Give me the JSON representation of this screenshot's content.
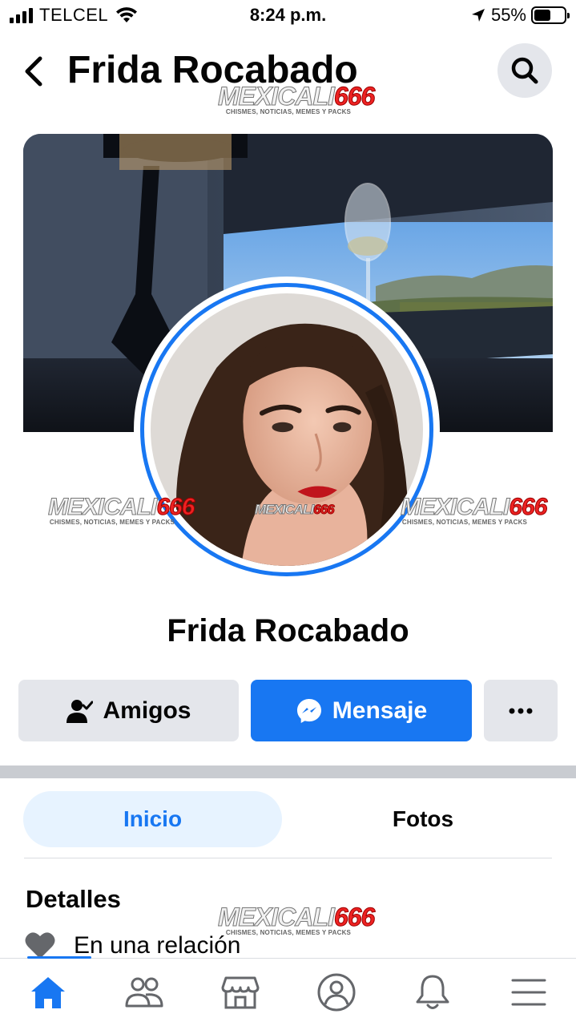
{
  "status_bar": {
    "carrier": "TELCEL",
    "time": "8:24 p.m.",
    "battery_percent": "55%",
    "battery_level": 0.55
  },
  "header": {
    "title": "Frida Rocabado"
  },
  "watermark": {
    "brand_a": "MEXICALI",
    "brand_b": "666",
    "tagline": "CHISMES, NOTICIAS, MEMES Y PACKS"
  },
  "profile": {
    "name": "Frida Rocabado"
  },
  "actions": {
    "friends_label": "Amigos",
    "message_label": "Mensaje"
  },
  "tabs": {
    "home_label": "Inicio",
    "photos_label": "Fotos"
  },
  "details": {
    "title": "Detalles",
    "relationship": "En una relación"
  },
  "colors": {
    "accent": "#1877f2",
    "button_gray": "#e4e6eb",
    "tab_active_bg": "#e7f3ff"
  },
  "icons": {
    "back": "chevron-left-icon",
    "search": "search-icon",
    "friends": "friend-check-icon",
    "messenger": "messenger-icon",
    "more": "more-dots-icon",
    "heart": "heart-icon",
    "nav": [
      "home-icon",
      "friends-icon",
      "marketplace-icon",
      "profile-icon",
      "bell-icon",
      "menu-icon"
    ]
  }
}
